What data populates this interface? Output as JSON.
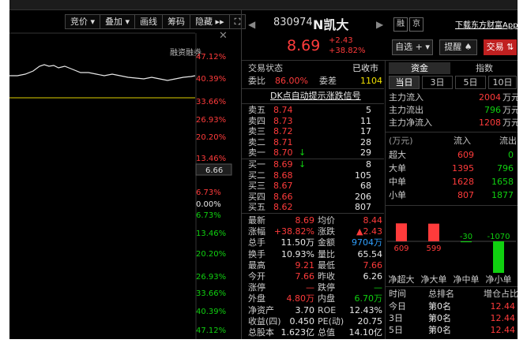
{
  "toolbar": {
    "items": [
      "竞价 ▾",
      "叠加 ▾",
      "画线",
      "筹码",
      "隐藏 ▸▸",
      "⛶"
    ]
  },
  "chart": {
    "close": "✕",
    "rzrq_label": "融资融券",
    "price_marker": "6.66",
    "y_labels": [
      {
        "t": "47.12%",
        "c": "red"
      },
      {
        "t": "40.39%",
        "c": "red"
      },
      {
        "t": "33.66%",
        "c": "red"
      },
      {
        "t": "26.93%",
        "c": "red"
      },
      {
        "t": "20.20%",
        "c": "red"
      },
      {
        "t": "13.46%",
        "c": "red"
      },
      {
        "t": "6.73%",
        "c": "red"
      },
      {
        "t": "0.00%",
        "c": "white"
      },
      {
        "t": "6.73%",
        "c": "green"
      },
      {
        "t": "13.46%",
        "c": "green"
      },
      {
        "t": "20.20%",
        "c": "green"
      },
      {
        "t": "26.93%",
        "c": "green"
      },
      {
        "t": "33.66%",
        "c": "green"
      },
      {
        "t": "40.39%",
        "c": "green"
      },
      {
        "t": "47.12%",
        "c": "green"
      }
    ]
  },
  "header": {
    "code": "830974",
    "name": "N凯大",
    "tag_rong": "融",
    "tag_jing": "京",
    "download": "下载东方财富App",
    "price": "8.69",
    "change": "+2.43",
    "change_pct": "+38.82%",
    "btn_zixuan": "自选 + ▾",
    "btn_tixing": "提醒 ♠",
    "btn_jiaoyi": "交易 ⇅"
  },
  "status": {
    "label": "交易状态",
    "value": "已收市",
    "weibi_label": "委比",
    "weibi": "86.00%",
    "weicha_label": "委差",
    "weicha": "1104"
  },
  "signal": "DK点自动提示涨跌信号",
  "sell": [
    {
      "n": "卖五",
      "p": "8.74",
      "v": "5",
      "a": ""
    },
    {
      "n": "卖四",
      "p": "8.73",
      "v": "11",
      "a": ""
    },
    {
      "n": "卖三",
      "p": "8.72",
      "v": "17",
      "a": ""
    },
    {
      "n": "卖二",
      "p": "8.71",
      "v": "28",
      "a": ""
    },
    {
      "n": "卖一",
      "p": "8.70",
      "v": "29",
      "a": "↓"
    }
  ],
  "buy": [
    {
      "n": "买一",
      "p": "8.69",
      "v": "8",
      "a": "↓"
    },
    {
      "n": "买二",
      "p": "8.68",
      "v": "105",
      "a": ""
    },
    {
      "n": "买三",
      "p": "8.67",
      "v": "68",
      "a": ""
    },
    {
      "n": "买四",
      "p": "8.66",
      "v": "206",
      "a": ""
    },
    {
      "n": "买五",
      "p": "8.62",
      "v": "807",
      "a": ""
    }
  ],
  "stats": [
    {
      "l1": "最新",
      "v1": "8.69",
      "c1": "red",
      "l2": "均价",
      "v2": "8.44",
      "c2": "red"
    },
    {
      "l1": "涨幅",
      "v1": "+38.82%",
      "c1": "red",
      "l2": "涨跌",
      "v2": "▲2.43",
      "c2": "red"
    },
    {
      "l1": "总手",
      "v1": "11.50万",
      "c1": "white",
      "l2": "金额",
      "v2": "9704万",
      "c2": "blue"
    },
    {
      "l1": "换手",
      "v1": "10.93%",
      "c1": "white",
      "l2": "量比",
      "v2": "65.54",
      "c2": "white"
    },
    {
      "l1": "最高",
      "v1": "9.21",
      "c1": "red",
      "l2": "最低",
      "v2": "7.66",
      "c2": "red"
    },
    {
      "l1": "今开",
      "v1": "7.66",
      "c1": "red",
      "l2": "昨收",
      "v2": "6.26",
      "c2": "white"
    },
    {
      "l1": "涨停",
      "v1": "—",
      "c1": "red",
      "l2": "跌停",
      "v2": "—",
      "c2": "green"
    },
    {
      "l1": "外盘",
      "v1": "4.80万",
      "c1": "red",
      "l2": "内盘",
      "v2": "6.70万",
      "c2": "green"
    },
    {
      "l1": "净资产",
      "v1": "3.70",
      "c1": "white",
      "l2": "ROE",
      "v2": "12.43%",
      "c2": "white"
    },
    {
      "l1": "收益(四)",
      "v1": "0.450",
      "c1": "white",
      "l2": "PE(动)",
      "v2": "20.75",
      "c2": "white"
    },
    {
      "l1": "总股本",
      "v1": "1.623亿",
      "c1": "white",
      "l2": "总值",
      "v2": "14.10亿",
      "c2": "white"
    }
  ],
  "fund": {
    "tab1": "资金",
    "tab2": "指数",
    "periods": [
      "当日",
      "3日",
      "5日",
      "10日"
    ],
    "flow": [
      {
        "l": "主力流入",
        "v": "2004",
        "u": "万元",
        "c": "red"
      },
      {
        "l": "主力流出",
        "v": "796",
        "u": "万元",
        "c": "green"
      },
      {
        "l": "主力净流入",
        "v": "1208",
        "u": "万元",
        "c": "red"
      }
    ],
    "unit": "(万元)",
    "col_in": "流入",
    "col_out": "流出",
    "rows": [
      {
        "l": "超大",
        "in": "609",
        "out": "0"
      },
      {
        "l": "大单",
        "in": "1395",
        "out": "796"
      },
      {
        "l": "中单",
        "in": "1628",
        "out": "1658"
      },
      {
        "l": "小单",
        "in": "807",
        "out": "1877"
      }
    ],
    "net": [
      {
        "label": "净超大",
        "value": 609
      },
      {
        "label": "净大单",
        "value": 599
      },
      {
        "label": "净中单",
        "value": -30
      },
      {
        "label": "净小单",
        "value": -1070
      }
    ],
    "rank_head": [
      "时间",
      "总排名",
      "增仓占比%"
    ],
    "rank": [
      {
        "t": "今日",
        "r": "第0名",
        "v": "12.44"
      },
      {
        "t": "3日",
        "r": "第0名",
        "v": "12.44"
      },
      {
        "t": "5日",
        "r": "第0名",
        "v": "12.44"
      }
    ]
  },
  "colors": {
    "up": "#ff3b3b",
    "down": "#10d010",
    "bg": "#000000"
  }
}
